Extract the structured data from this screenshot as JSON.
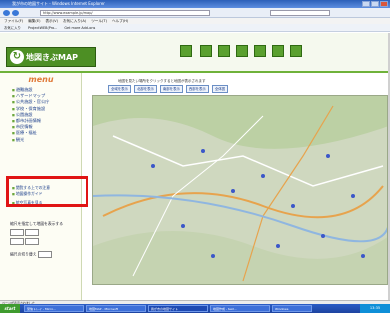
{
  "window": {
    "title": "我が市の地図サイト - Windows Internet Explorer"
  },
  "address": {
    "url": "http://www.example.jp/map/",
    "search_placeholder": ""
  },
  "menubar": {
    "items": [
      "ファイル(F)",
      "編集(E)",
      "表示(V)",
      "お気に入り(A)",
      "ツール(T)",
      "ヘルプ(H)"
    ]
  },
  "favorites": {
    "items": [
      "お気に入り",
      "ProjectWEB(Pro...",
      "Get more Add-ons"
    ]
  },
  "header": {
    "site_name": "地図きぶMAP"
  },
  "sidebar": {
    "title": "menu",
    "items": [
      "避難施設",
      "ハザードマップ",
      "公共施設・官公庁",
      "学校・保育施設",
      "公園施設",
      "都市計画情報",
      "市民情報",
      "医療・福祉",
      "観光"
    ],
    "extra_items": [
      "閲覧する上での注意",
      "地図操作ガイド",
      "航空写真を見る"
    ],
    "zoom_label": "縮尺を指定して地図を表示する",
    "scale_label": "縮尺の切り替え"
  },
  "map": {
    "note": "地図を見たい場所をクリックすると地図が表示されます",
    "tabs": [
      "全域を表示",
      "北部を表示",
      "南部を表示",
      "西部を表示",
      "全体図"
    ]
  },
  "statusbar": {
    "text": "ページが表示されました"
  },
  "taskbar": {
    "start": "start",
    "buttons": [
      "受信トレイ - Micro...",
      "地図MAP - Microsoft",
      "我が市の地図サイト",
      "地図作成 - test...",
      "Windows"
    ],
    "clock": "13:35"
  }
}
